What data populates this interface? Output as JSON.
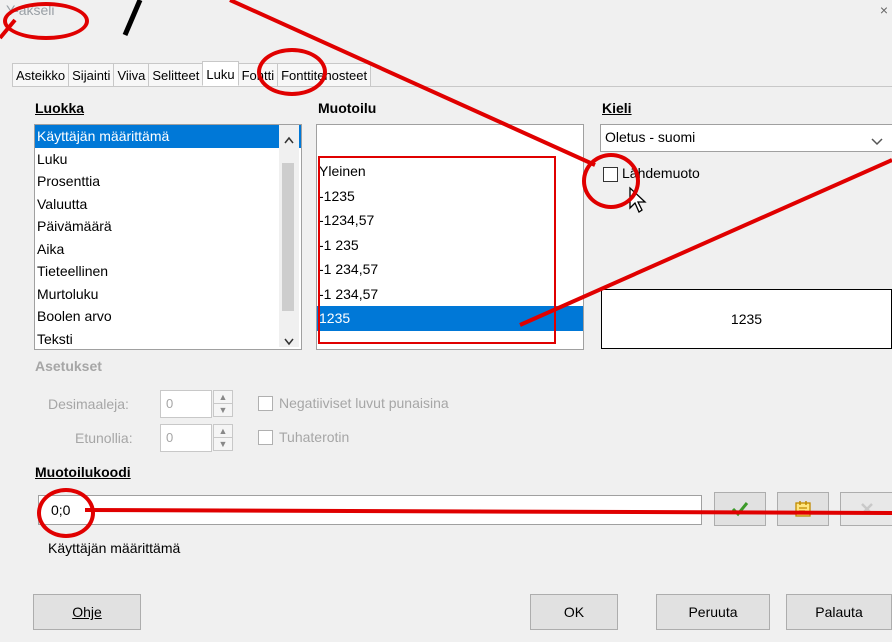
{
  "window": {
    "title": "Y-akseli",
    "close_glyph": "×"
  },
  "tabs": [
    "Asteikko",
    "Sijainti",
    "Viiva",
    "Selitteet",
    "Luku",
    "Fontti",
    "Fonttitehosteet"
  ],
  "active_tab": "Luku",
  "category": {
    "heading": "Luokka",
    "items": [
      "Käyttäjän määrittämä",
      "Luku",
      "Prosenttia",
      "Valuutta",
      "Päivämäärä",
      "Aika",
      "Tieteellinen",
      "Murtoluku",
      "Boolen arvo",
      "Teksti"
    ],
    "selected": "Käyttäjän määrittämä"
  },
  "format": {
    "heading": "Muotoilu",
    "items": [
      "",
      "Yleinen",
      "-1235",
      "-1234,57",
      "-1 235",
      "-1 234,57",
      "-1 234,57",
      "1235"
    ],
    "selected": "1235"
  },
  "language": {
    "heading": "Kieli",
    "value": "Oletus - suomi",
    "source_format_label": "Lähdemuoto",
    "source_format_checked": false,
    "preview": "1235"
  },
  "options": {
    "heading": "Asetukset",
    "decimals_label": "Desimaaleja:",
    "decimals_value": "0",
    "leading_zeros_label": "Etunollia:",
    "leading_zeros_value": "0",
    "negative_red_label": "Negatiiviset luvut punaisina",
    "thousands_sep_label": "Tuhaterotin"
  },
  "format_code": {
    "heading": "Muotoilukoodi",
    "value": "0;0",
    "description": "Käyttäjän määrittämä"
  },
  "buttons": {
    "help": "Ohje",
    "ok": "OK",
    "cancel": "Peruuta",
    "reset": "Palauta"
  },
  "colors": {
    "selection": "#0078d7",
    "annotation": "#e00000",
    "check": "#3c9a29",
    "comment": "#d6a400"
  }
}
